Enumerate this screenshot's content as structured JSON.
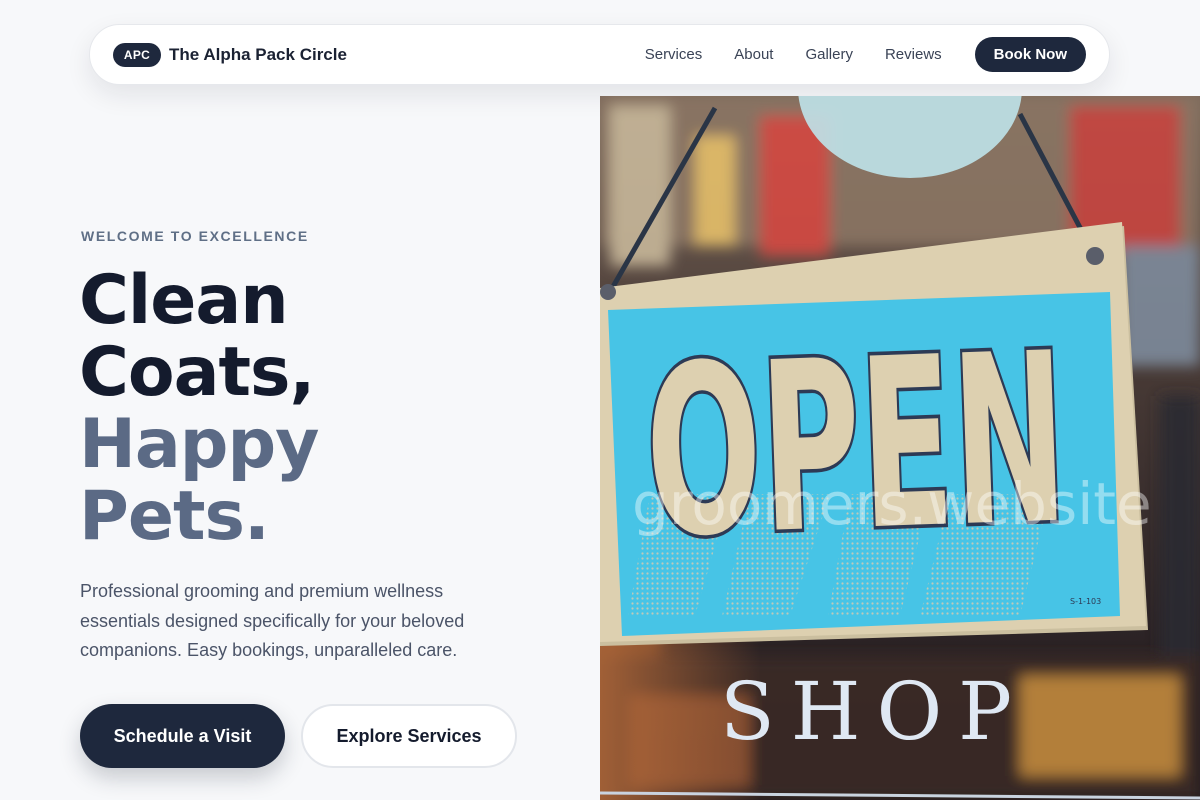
{
  "nav": {
    "badge": "APC",
    "brand": "The Alpha Pack Circle",
    "links": [
      "Services",
      "About",
      "Gallery",
      "Reviews"
    ],
    "cta": "Book Now"
  },
  "hero": {
    "eyebrow": "WELCOME TO EXCELLENCE",
    "headline_dark": [
      "Clean",
      "Coats,"
    ],
    "headline_accent": [
      "Happy",
      "Pets."
    ],
    "description": "Professional grooming and premium wellness essentials designed specifically for your beloved companions. Easy bookings, unparalleled care.",
    "primary_button": "Schedule a Visit",
    "secondary_button": "Explore Services"
  },
  "image": {
    "sign_text": "OPEN",
    "window_text": "SHOP",
    "watermark": "groomers.website",
    "small_print": "S-1-103"
  },
  "colors": {
    "navy": "#1e283d",
    "muted_slate": "#5b6a85",
    "sign_cyan": "#47c4e6",
    "sign_board": "#dccfae"
  }
}
